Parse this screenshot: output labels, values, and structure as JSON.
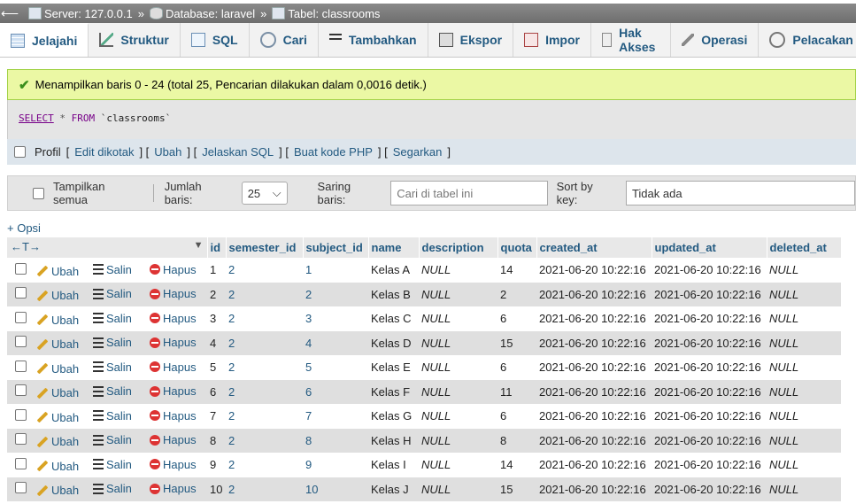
{
  "breadcrumb": {
    "server": "Server: 127.0.0.1",
    "database": "Database: laravel",
    "table": "Tabel: classrooms",
    "sep": "»"
  },
  "tabs": [
    {
      "label": "Jelajahi",
      "icon": "browse-icon"
    },
    {
      "label": "Struktur",
      "icon": "structure-icon"
    },
    {
      "label": "SQL",
      "icon": "sql-icon"
    },
    {
      "label": "Cari",
      "icon": "search-icon"
    },
    {
      "label": "Tambahkan",
      "icon": "insert-icon"
    },
    {
      "label": "Ekspor",
      "icon": "export-icon"
    },
    {
      "label": "Impor",
      "icon": "import-icon"
    },
    {
      "label": "Hak Akses",
      "icon": "privileges-icon"
    },
    {
      "label": "Operasi",
      "icon": "operations-icon"
    },
    {
      "label": "Pelacakan",
      "icon": "tracking-icon"
    }
  ],
  "success": "Menampilkan baris 0 - 24 (total 25, Pencarian dilakukan dalam 0,0016 detik.)",
  "sql": {
    "select": "SELECT",
    "star": "*",
    "from": "FROM",
    "table": "`classrooms`"
  },
  "profil": {
    "label": "Profil",
    "links": [
      "Edit dikotak",
      "Ubah",
      "Jelaskan SQL",
      "Buat kode PHP",
      "Segarkan"
    ]
  },
  "nav": {
    "show_all": "Tampilkan semua",
    "rows_label": "Jumlah baris:",
    "rows_value": "25",
    "filter_label": "Saring baris:",
    "filter_placeholder": "Cari di tabel ini",
    "sort_label": "Sort by key:",
    "sort_value": "Tidak ada"
  },
  "opsi": "+ Opsi",
  "arrows": "←T→",
  "columns": [
    "id",
    "semester_id",
    "subject_id",
    "name",
    "description",
    "quota",
    "created_at",
    "updated_at",
    "deleted_at"
  ],
  "actions": {
    "edit": "Ubah",
    "copy": "Salin",
    "delete": "Hapus"
  },
  "rows": [
    [
      "1",
      "2",
      "1",
      "Kelas A",
      "NULL",
      "14",
      "2021-06-20 10:22:16",
      "2021-06-20 10:22:16",
      "NULL"
    ],
    [
      "2",
      "2",
      "2",
      "Kelas B",
      "NULL",
      "2",
      "2021-06-20 10:22:16",
      "2021-06-20 10:22:16",
      "NULL"
    ],
    [
      "3",
      "2",
      "3",
      "Kelas C",
      "NULL",
      "6",
      "2021-06-20 10:22:16",
      "2021-06-20 10:22:16",
      "NULL"
    ],
    [
      "4",
      "2",
      "4",
      "Kelas D",
      "NULL",
      "15",
      "2021-06-20 10:22:16",
      "2021-06-20 10:22:16",
      "NULL"
    ],
    [
      "5",
      "2",
      "5",
      "Kelas E",
      "NULL",
      "6",
      "2021-06-20 10:22:16",
      "2021-06-20 10:22:16",
      "NULL"
    ],
    [
      "6",
      "2",
      "6",
      "Kelas F",
      "NULL",
      "11",
      "2021-06-20 10:22:16",
      "2021-06-20 10:22:16",
      "NULL"
    ],
    [
      "7",
      "2",
      "7",
      "Kelas G",
      "NULL",
      "6",
      "2021-06-20 10:22:16",
      "2021-06-20 10:22:16",
      "NULL"
    ],
    [
      "8",
      "2",
      "8",
      "Kelas H",
      "NULL",
      "8",
      "2021-06-20 10:22:16",
      "2021-06-20 10:22:16",
      "NULL"
    ],
    [
      "9",
      "2",
      "9",
      "Kelas I",
      "NULL",
      "14",
      "2021-06-20 10:22:16",
      "2021-06-20 10:22:16",
      "NULL"
    ],
    [
      "10",
      "2",
      "10",
      "Kelas J",
      "NULL",
      "15",
      "2021-06-20 10:22:16",
      "2021-06-20 10:22:16",
      "NULL"
    ]
  ]
}
